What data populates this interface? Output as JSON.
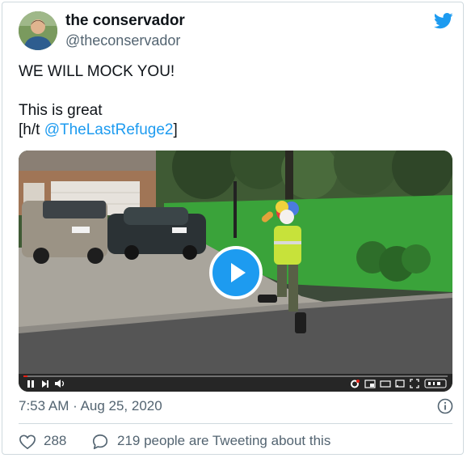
{
  "tweet": {
    "author_name": "the conservador",
    "author_handle": "@theconservador",
    "text_line1": "WE WILL MOCK YOU!",
    "text_line2": "This is great",
    "text_line3_prefix": "[h/t ",
    "mention": "@TheLastRefuge2",
    "text_line3_suffix": "]",
    "timestamp": "7:53 AM · Aug 25, 2020",
    "like_count": "288",
    "conversation_text": "219 people are Tweeting about this"
  },
  "video": {
    "progress": 0.01
  },
  "colors": {
    "accent": "#1d9bf0",
    "text": "#0f1419",
    "muted": "#536471",
    "border": "#cfd9de"
  },
  "icons": {
    "brand": "twitter-bird-icon",
    "play": "play-icon",
    "info": "info-icon",
    "like": "heart-icon",
    "reply": "speech-bubble-icon"
  }
}
